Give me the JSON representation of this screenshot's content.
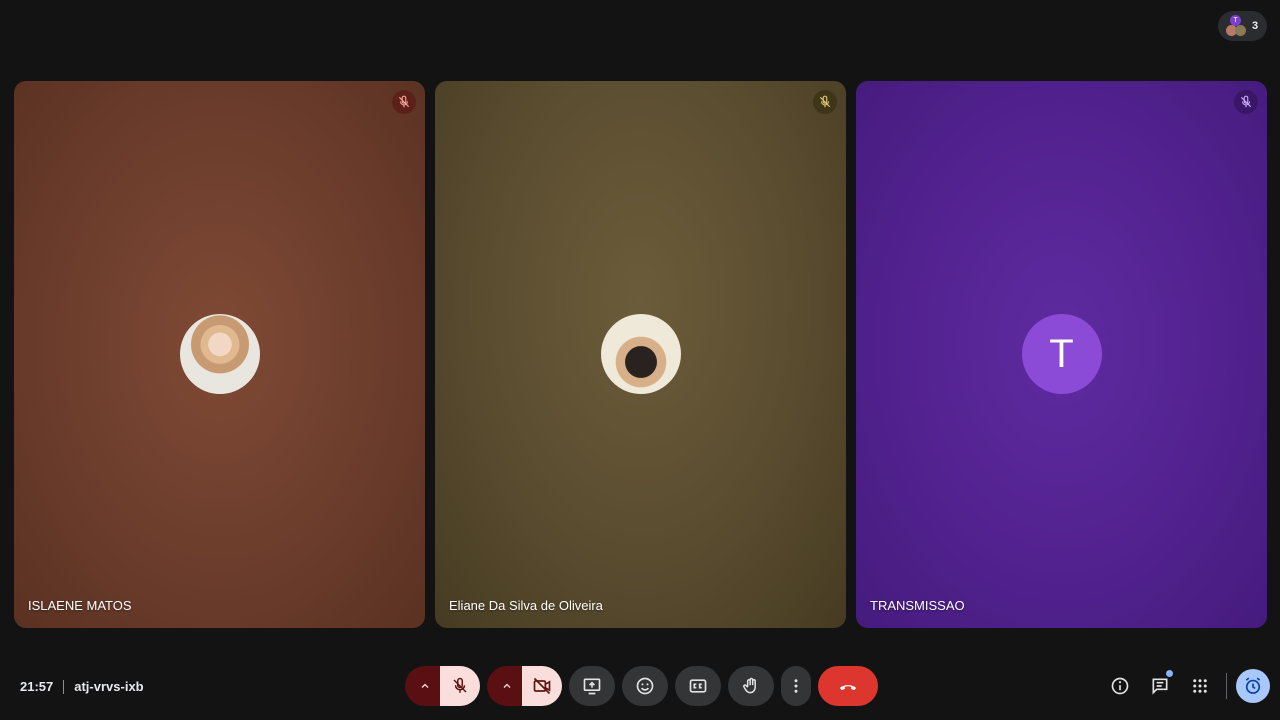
{
  "header": {
    "participants_count": "3",
    "participant_initial": "T"
  },
  "tiles": [
    {
      "name": "ISLAENE MATOS",
      "avatar": "photo",
      "muted": true,
      "color": "#6c3d2c"
    },
    {
      "name": "Eliane Da Silva de Oliveira",
      "avatar": "photo",
      "muted": true,
      "color": "#5a4c2f"
    },
    {
      "name": "TRANSMISSAO",
      "avatar": "letter",
      "initial": "T",
      "muted": true,
      "color": "#52228f"
    }
  ],
  "meeting": {
    "time": "21:57",
    "code": "atj-vrvs-ixb"
  },
  "controls": {
    "mic": "mic-off-icon",
    "camera": "camera-off-icon",
    "present": "present-screen-icon",
    "reactions": "emoji-icon",
    "captions": "captions-icon",
    "raise_hand": "hand-icon",
    "more": "more-vert-icon",
    "end_call": "call-end-icon",
    "end_color": "#dc362e"
  },
  "tools": {
    "info": "info-icon",
    "chat": "chat-icon",
    "activities": "apps-grid-icon",
    "timer": "alarm-icon",
    "accent": "#a8c7fa"
  }
}
